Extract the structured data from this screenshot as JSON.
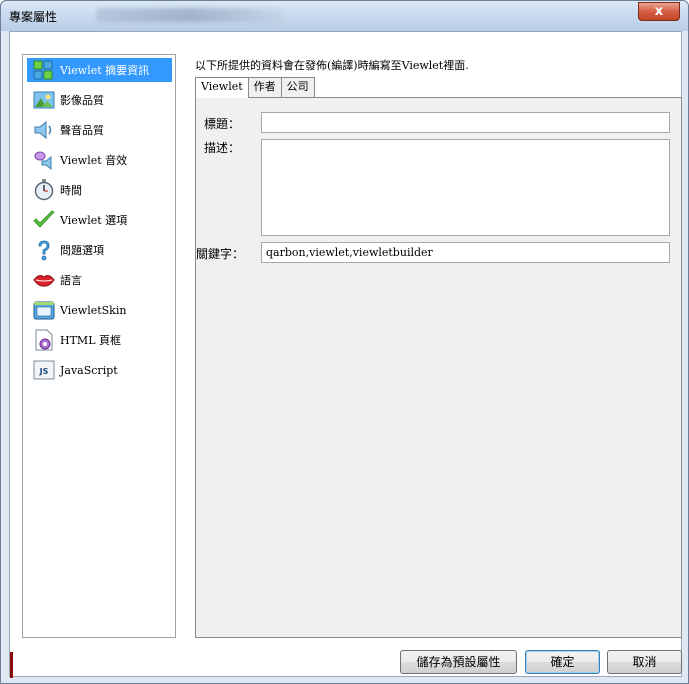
{
  "window": {
    "title": "專案屬性",
    "close_glyph": "x"
  },
  "nav": {
    "items": [
      {
        "label": "Viewlet 摘要資訊",
        "icon": "summary-info-icon",
        "selected": true
      },
      {
        "label": "影像品質",
        "icon": "image-quality-icon",
        "selected": false
      },
      {
        "label": "聲音品質",
        "icon": "speaker-icon",
        "selected": false
      },
      {
        "label": "Viewlet 音效",
        "icon": "sound-effect-icon",
        "selected": false
      },
      {
        "label": "時間",
        "icon": "stopwatch-icon",
        "selected": false
      },
      {
        "label": "Viewlet 選項",
        "icon": "checkmark-icon",
        "selected": false
      },
      {
        "label": "問題選項",
        "icon": "question-icon",
        "selected": false
      },
      {
        "label": "語言",
        "icon": "lips-icon",
        "selected": false
      },
      {
        "label": "ViewletSkin",
        "icon": "skin-window-icon",
        "selected": false
      },
      {
        "label": "HTML 頁框",
        "icon": "html-page-icon",
        "selected": false
      },
      {
        "label": "JavaScript",
        "icon": "javascript-icon",
        "selected": false
      }
    ]
  },
  "content": {
    "description": "以下所提供的資料會在發佈(編譯)時編寫至Viewlet裡面.",
    "tabs": [
      {
        "label": "Viewlet",
        "active": true
      },
      {
        "label": "作者",
        "active": false
      },
      {
        "label": "公司",
        "active": false
      }
    ],
    "fields": {
      "title_label": "標題：",
      "title_value": "",
      "description_label": "描述：",
      "description_value": "",
      "keywords_label": "關鍵字：",
      "keywords_value": "qarbon,viewlet,viewletbuilder"
    }
  },
  "buttons": {
    "save_default": "儲存為預設屬性",
    "ok": "確定",
    "cancel": "取消"
  },
  "colors": {
    "selection": "#3399ff",
    "panel_bg": "#f0f0f0",
    "close_button": "#d65f45"
  }
}
